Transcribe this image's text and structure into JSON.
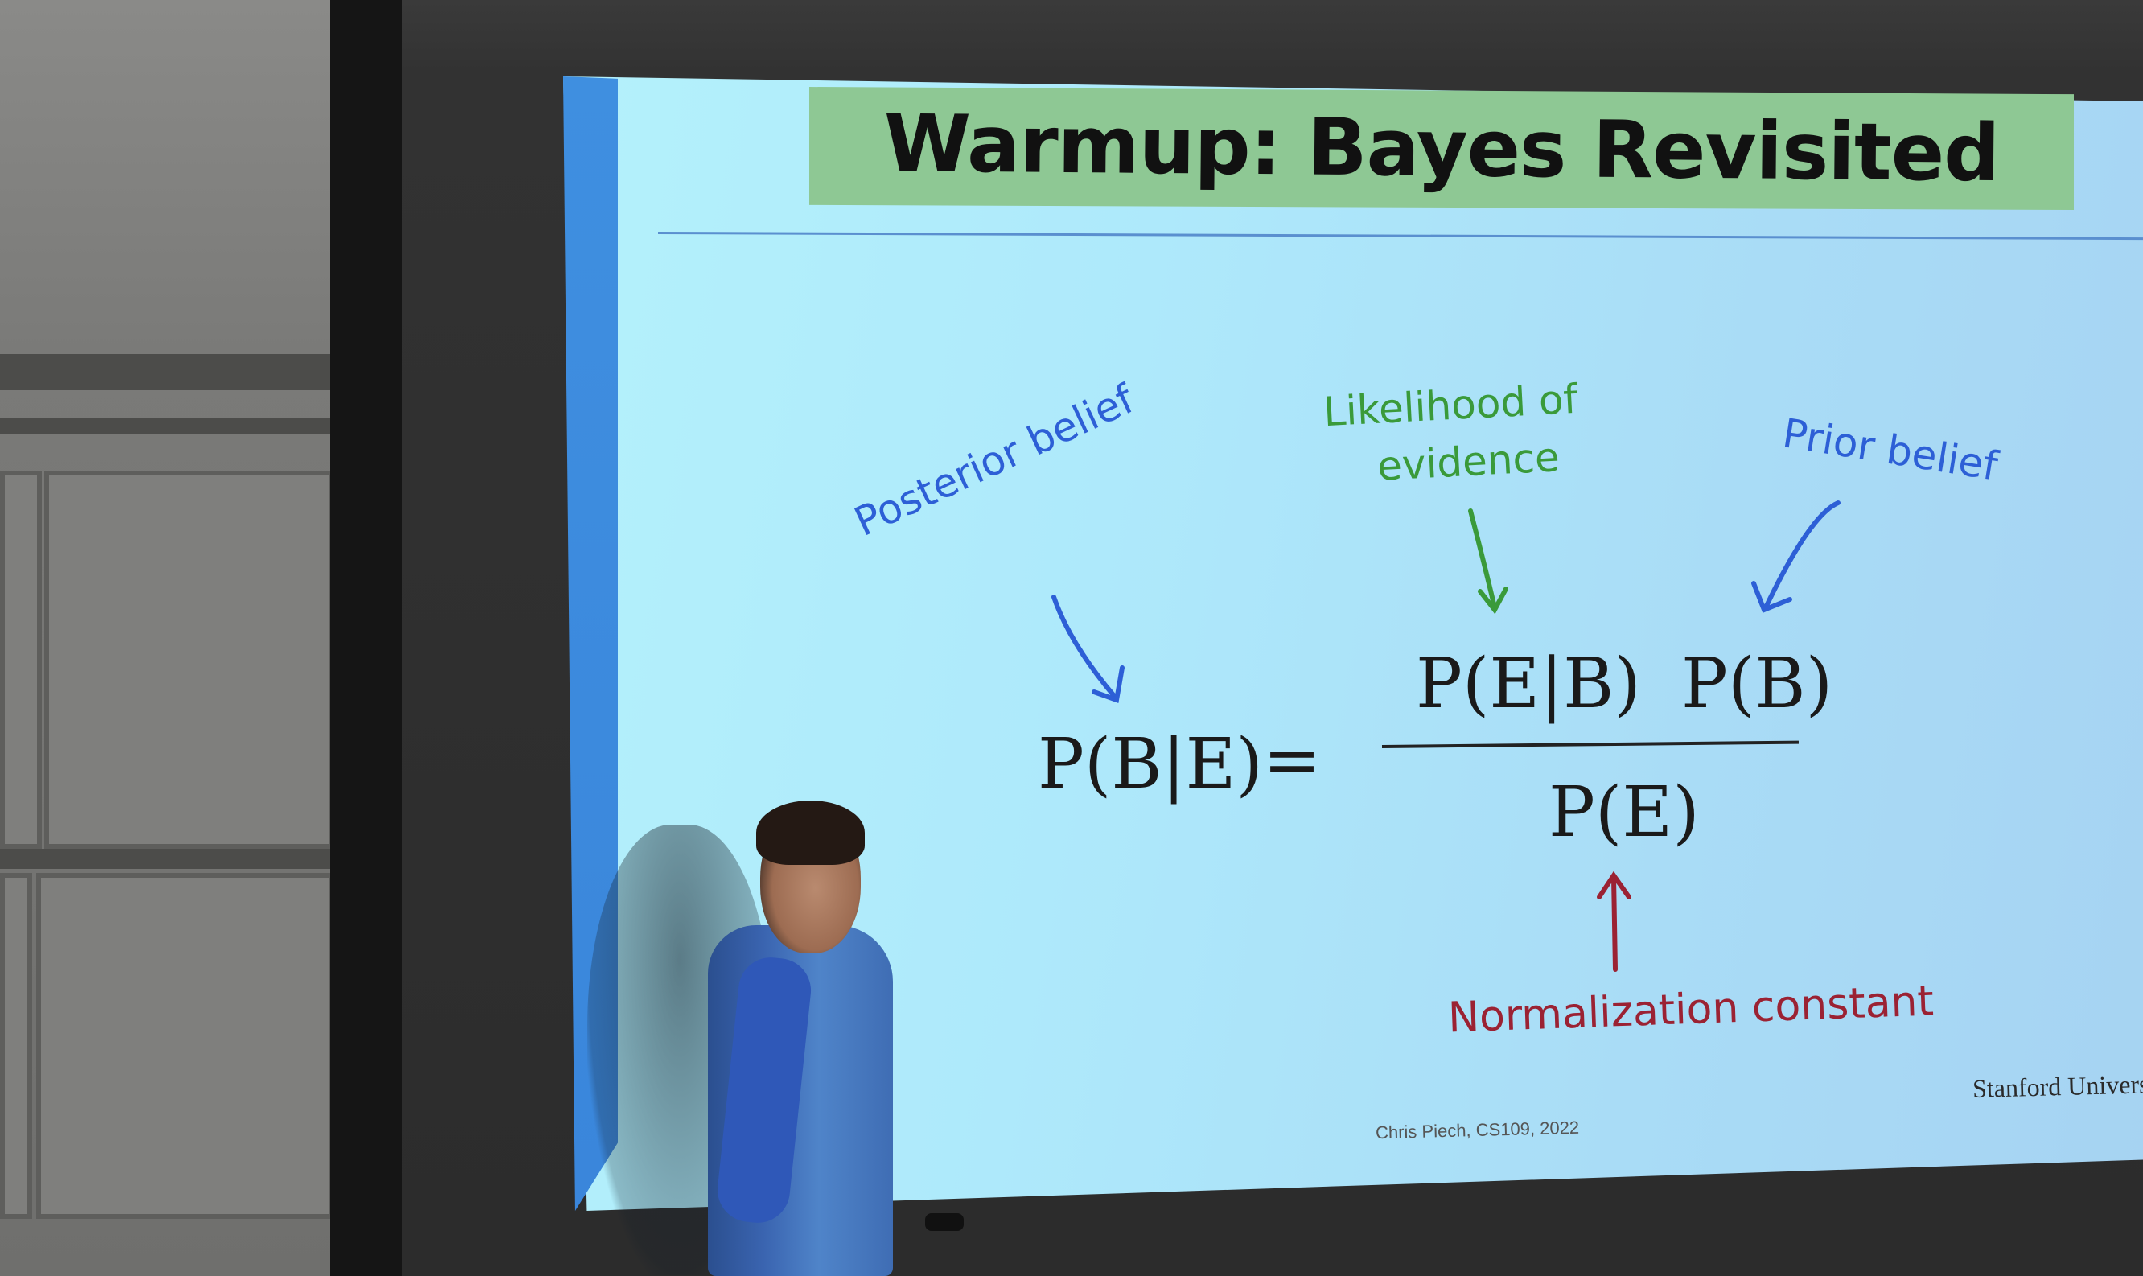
{
  "slide": {
    "title": "Warmup: Bayes Revisited",
    "annotations": {
      "posterior": "Posterior belief",
      "likelihood_line1": "Likelihood of",
      "likelihood_line2": "evidence",
      "prior": "Prior belief",
      "normalization": "Normalization constant"
    },
    "formula": {
      "lhs": "P(B|E)",
      "equals": "=",
      "numerator_left": "P(E|B)",
      "numerator_right": "P(B)",
      "denominator": "P(E)"
    },
    "footer": "Chris Piech, CS109, 2022",
    "institution": "Stanford Universi"
  },
  "colors": {
    "title_bar": "#8ec894",
    "slide_background": "#aee9fb",
    "posterior_label": "#2d5fd6",
    "likelihood_label": "#3a9a3a",
    "prior_label": "#2d5fd6",
    "normalization_label": "#9b2233"
  }
}
